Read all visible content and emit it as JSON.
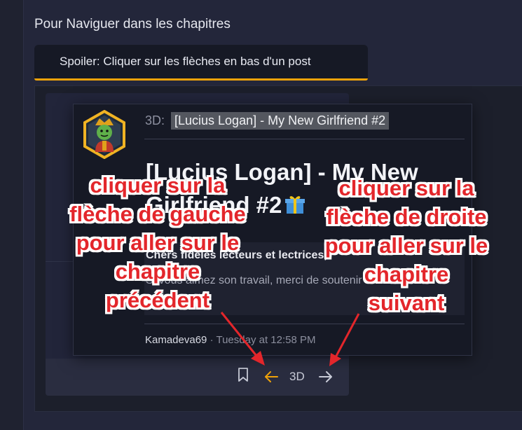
{
  "section": {
    "title": "Pour Naviguer dans les chapitres"
  },
  "spoiler": {
    "label": "Spoiler: Cliquer sur les flèches en bas d'un post"
  },
  "tooltip": {
    "prefix": "3D:",
    "thread_title": "[Lucius Logan] - My New Girlfriend #2",
    "heading": "[Lucius Logan] - My New Girlfriend #2",
    "excerpt_line1": "Chers fidèles lecteurs et lectrices,",
    "excerpt_line2": "Si vous aimez son travail, merci de soutenir",
    "author": "Kamadeva69",
    "separator": "·",
    "date": "Tuesday at 12:58 PM"
  },
  "post_footer": {
    "tag": "3D"
  },
  "annotations": {
    "left": [
      "cliquer sur la",
      "flèche de gauche",
      "pour aller sur le",
      "chapitre",
      "précédent"
    ],
    "right": [
      "cliquer sur la",
      "flèche de droite",
      "pour aller sur le",
      "chapitre",
      "suivant"
    ]
  },
  "colors": {
    "accent": "#f0a30a",
    "annotation": "#e3262b",
    "background": "#1f2230"
  },
  "icons": {
    "bookmark": "bookmark-icon",
    "prev": "arrow-left-icon",
    "next": "arrow-right-icon",
    "gift": "gift-icon"
  }
}
